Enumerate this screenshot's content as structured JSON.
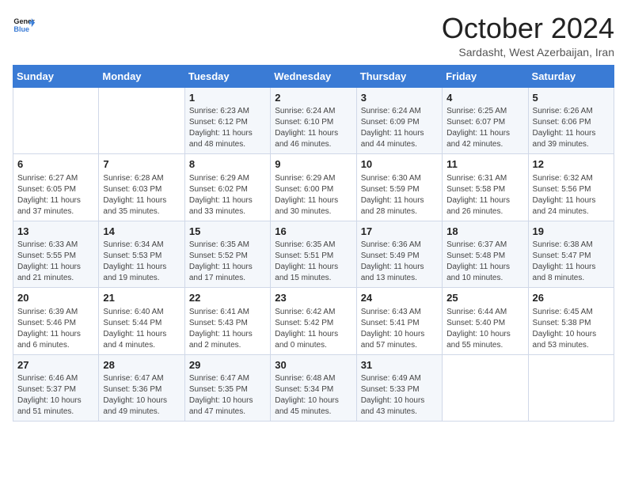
{
  "logo": {
    "line1": "General",
    "line2": "Blue"
  },
  "header": {
    "month": "October 2024",
    "location": "Sardasht, West Azerbaijan, Iran"
  },
  "days_of_week": [
    "Sunday",
    "Monday",
    "Tuesday",
    "Wednesday",
    "Thursday",
    "Friday",
    "Saturday"
  ],
  "weeks": [
    [
      {
        "num": "",
        "info": ""
      },
      {
        "num": "",
        "info": ""
      },
      {
        "num": "1",
        "info": "Sunrise: 6:23 AM\nSunset: 6:12 PM\nDaylight: 11 hours and 48 minutes."
      },
      {
        "num": "2",
        "info": "Sunrise: 6:24 AM\nSunset: 6:10 PM\nDaylight: 11 hours and 46 minutes."
      },
      {
        "num": "3",
        "info": "Sunrise: 6:24 AM\nSunset: 6:09 PM\nDaylight: 11 hours and 44 minutes."
      },
      {
        "num": "4",
        "info": "Sunrise: 6:25 AM\nSunset: 6:07 PM\nDaylight: 11 hours and 42 minutes."
      },
      {
        "num": "5",
        "info": "Sunrise: 6:26 AM\nSunset: 6:06 PM\nDaylight: 11 hours and 39 minutes."
      }
    ],
    [
      {
        "num": "6",
        "info": "Sunrise: 6:27 AM\nSunset: 6:05 PM\nDaylight: 11 hours and 37 minutes."
      },
      {
        "num": "7",
        "info": "Sunrise: 6:28 AM\nSunset: 6:03 PM\nDaylight: 11 hours and 35 minutes."
      },
      {
        "num": "8",
        "info": "Sunrise: 6:29 AM\nSunset: 6:02 PM\nDaylight: 11 hours and 33 minutes."
      },
      {
        "num": "9",
        "info": "Sunrise: 6:29 AM\nSunset: 6:00 PM\nDaylight: 11 hours and 30 minutes."
      },
      {
        "num": "10",
        "info": "Sunrise: 6:30 AM\nSunset: 5:59 PM\nDaylight: 11 hours and 28 minutes."
      },
      {
        "num": "11",
        "info": "Sunrise: 6:31 AM\nSunset: 5:58 PM\nDaylight: 11 hours and 26 minutes."
      },
      {
        "num": "12",
        "info": "Sunrise: 6:32 AM\nSunset: 5:56 PM\nDaylight: 11 hours and 24 minutes."
      }
    ],
    [
      {
        "num": "13",
        "info": "Sunrise: 6:33 AM\nSunset: 5:55 PM\nDaylight: 11 hours and 21 minutes."
      },
      {
        "num": "14",
        "info": "Sunrise: 6:34 AM\nSunset: 5:53 PM\nDaylight: 11 hours and 19 minutes."
      },
      {
        "num": "15",
        "info": "Sunrise: 6:35 AM\nSunset: 5:52 PM\nDaylight: 11 hours and 17 minutes."
      },
      {
        "num": "16",
        "info": "Sunrise: 6:35 AM\nSunset: 5:51 PM\nDaylight: 11 hours and 15 minutes."
      },
      {
        "num": "17",
        "info": "Sunrise: 6:36 AM\nSunset: 5:49 PM\nDaylight: 11 hours and 13 minutes."
      },
      {
        "num": "18",
        "info": "Sunrise: 6:37 AM\nSunset: 5:48 PM\nDaylight: 11 hours and 10 minutes."
      },
      {
        "num": "19",
        "info": "Sunrise: 6:38 AM\nSunset: 5:47 PM\nDaylight: 11 hours and 8 minutes."
      }
    ],
    [
      {
        "num": "20",
        "info": "Sunrise: 6:39 AM\nSunset: 5:46 PM\nDaylight: 11 hours and 6 minutes."
      },
      {
        "num": "21",
        "info": "Sunrise: 6:40 AM\nSunset: 5:44 PM\nDaylight: 11 hours and 4 minutes."
      },
      {
        "num": "22",
        "info": "Sunrise: 6:41 AM\nSunset: 5:43 PM\nDaylight: 11 hours and 2 minutes."
      },
      {
        "num": "23",
        "info": "Sunrise: 6:42 AM\nSunset: 5:42 PM\nDaylight: 11 hours and 0 minutes."
      },
      {
        "num": "24",
        "info": "Sunrise: 6:43 AM\nSunset: 5:41 PM\nDaylight: 10 hours and 57 minutes."
      },
      {
        "num": "25",
        "info": "Sunrise: 6:44 AM\nSunset: 5:40 PM\nDaylight: 10 hours and 55 minutes."
      },
      {
        "num": "26",
        "info": "Sunrise: 6:45 AM\nSunset: 5:38 PM\nDaylight: 10 hours and 53 minutes."
      }
    ],
    [
      {
        "num": "27",
        "info": "Sunrise: 6:46 AM\nSunset: 5:37 PM\nDaylight: 10 hours and 51 minutes."
      },
      {
        "num": "28",
        "info": "Sunrise: 6:47 AM\nSunset: 5:36 PM\nDaylight: 10 hours and 49 minutes."
      },
      {
        "num": "29",
        "info": "Sunrise: 6:47 AM\nSunset: 5:35 PM\nDaylight: 10 hours and 47 minutes."
      },
      {
        "num": "30",
        "info": "Sunrise: 6:48 AM\nSunset: 5:34 PM\nDaylight: 10 hours and 45 minutes."
      },
      {
        "num": "31",
        "info": "Sunrise: 6:49 AM\nSunset: 5:33 PM\nDaylight: 10 hours and 43 minutes."
      },
      {
        "num": "",
        "info": ""
      },
      {
        "num": "",
        "info": ""
      }
    ]
  ]
}
